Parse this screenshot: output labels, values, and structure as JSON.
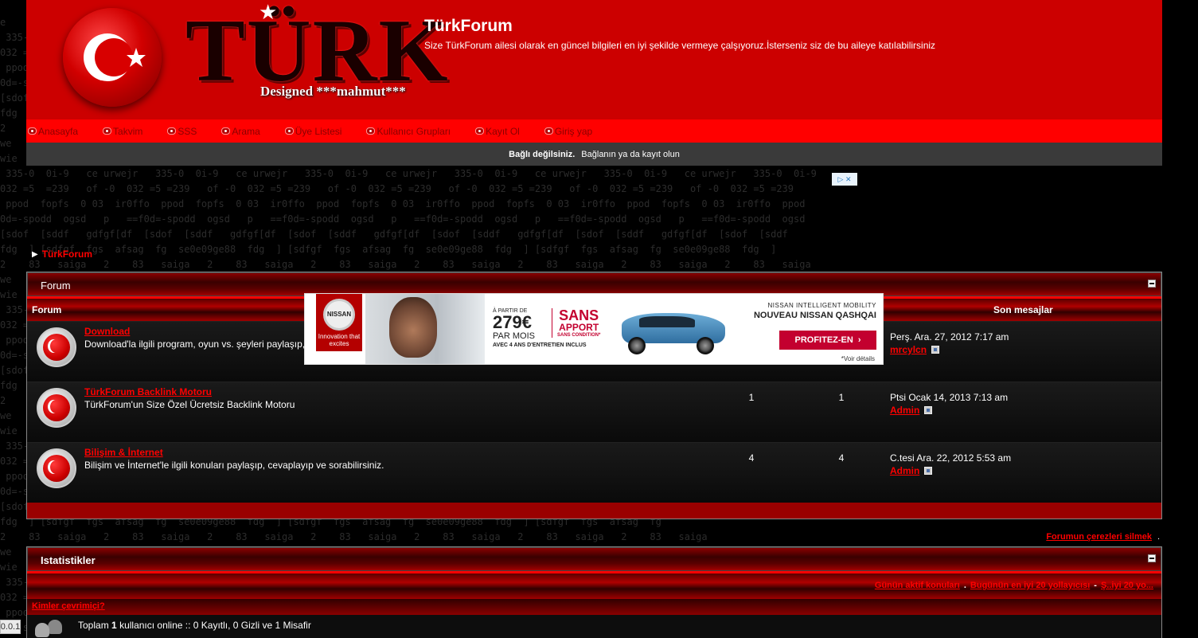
{
  "header": {
    "logo_word": "TÜRK",
    "logo_designed": "Designed ***mahmut***",
    "site_title": "TürkForum",
    "site_description": "Size TürkForum ailesi olarak en güncel bilgileri en iyi şekilde vermeye çalşıyoruz.İsterseniz siz de bu aileye katılabilirsiniz"
  },
  "nav": {
    "items": [
      {
        "label": "Anasayfa",
        "icon": "home-icon"
      },
      {
        "label": "Takvim",
        "icon": "calendar-icon"
      },
      {
        "label": "SSS",
        "icon": "faq-icon"
      },
      {
        "label": "Arama",
        "icon": "search-icon"
      },
      {
        "label": "Üye Listesi",
        "icon": "members-icon"
      },
      {
        "label": "Kullanıcı Grupları",
        "icon": "groups-icon"
      },
      {
        "label": "Kayıt Ol",
        "icon": "register-icon"
      },
      {
        "label": "Giriş yap",
        "icon": "login-icon"
      }
    ]
  },
  "loginbar": {
    "status": "Bağlı değilsiniz.",
    "link": "Bağlanın ya da kayıt olun"
  },
  "breadcrumb": {
    "label": "TürkForum"
  },
  "forum_box": {
    "title": "Forum",
    "col_forum": "Forum",
    "col_last": "Son mesajlar",
    "rows": [
      {
        "title": "Download",
        "desc": "Download'la ilgili program, oyun vs. şeyleri paylaşıp,",
        "topics": "",
        "posts": "",
        "last_date": "Perş. Ara. 27, 2012 7:17 am",
        "last_user": "mrcylcn"
      },
      {
        "title": "TürkForum Backlink Motoru",
        "desc": "TürkForum'un Size Özel Ücretsiz Backlink Motoru",
        "topics": "1",
        "posts": "1",
        "last_date": "Ptsi Ocak 14, 2013 7:13 am",
        "last_user": "Admin"
      },
      {
        "title": "Bilişim & İnternet",
        "desc": "Bilişim ve İnternet'le ilgili konuları paylaşıp, cevaplayıp ve sorabilirsiniz.",
        "topics": "4",
        "posts": "4",
        "last_date": "C.tesi Ara. 22, 2012 5:53 am",
        "last_user": "Admin"
      }
    ]
  },
  "ad": {
    "brand_logo": "NISSAN",
    "brand_tag": "Innovation that excites",
    "price_prefix": "À PARTIR DE",
    "price": "279€",
    "price_period": "PAR MOIS",
    "price_note": "AVEC 4 ANS D'ENTRETIEN INCLUS",
    "sans_1": "SANS",
    "sans_2": "APPORT",
    "sans_3": "SANS CONDITION*",
    "brand_line": "NISSAN INTELLIGENT MOBILITY",
    "model": "NOUVEAU NISSAN QASHQAI",
    "cta": "PROFITEZ-EN",
    "footnote": "*Voir détails"
  },
  "cookies_link": "Forumun çerezleri silmek",
  "stats_box": {
    "title": "Istatistikler",
    "links": [
      "Günün aktif konuları",
      "Bugünün en iyi 20 yollayıcısı",
      "Ş..iyi 20 yo..."
    ],
    "who_online": "Kimler çevrimiçi?",
    "online_prefix": "Toplam",
    "online_count": "1",
    "online_suffix": "kullanıcı online :: 0 Kayıtlı, 0 Gizli ve 1 Misafir"
  },
  "browser_tab_fragment": "0.0.1",
  "colors": {
    "header_red": "#cc0000",
    "nav_red": "#ff0000",
    "link_red": "#ff0000",
    "background": "#000000"
  }
}
